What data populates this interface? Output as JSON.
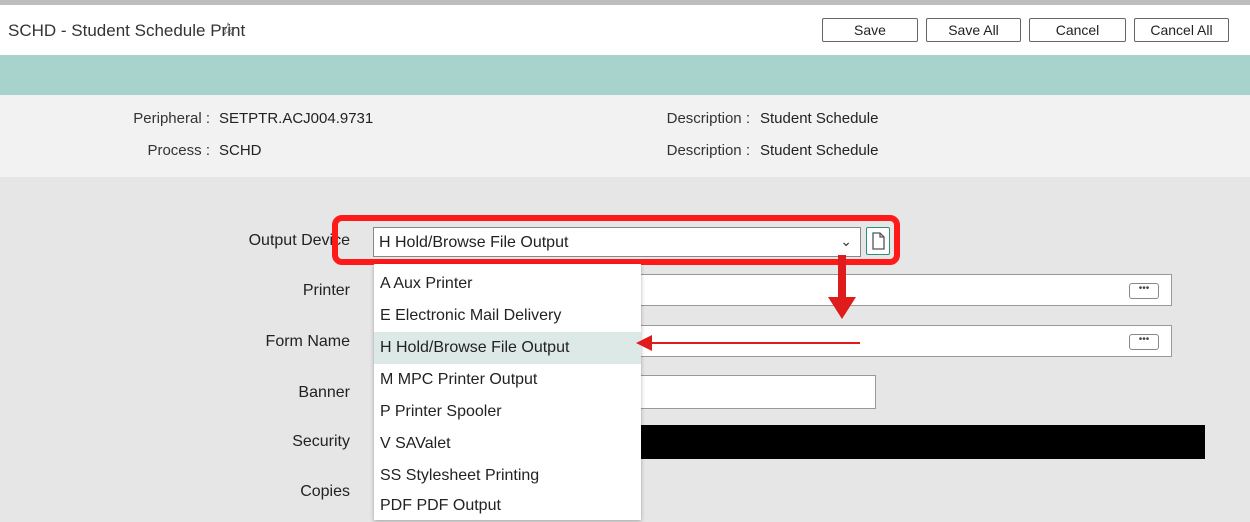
{
  "window": {
    "title": "SCHD - Student Schedule Print",
    "star_icon": "star-outline-icon"
  },
  "toolbar": {
    "save": "Save",
    "save_all": "Save All",
    "cancel": "Cancel",
    "cancel_all": "Cancel All"
  },
  "info": {
    "peripheral_label": "Peripheral :",
    "peripheral_value": "SETPTR.ACJ004.9731",
    "process_label": "Process :",
    "process_value": "SCHD",
    "desc1_label": "Description :",
    "desc1_value": "Student Schedule",
    "desc2_label": "Description :",
    "desc2_value": "Student Schedule"
  },
  "form": {
    "output_device_label": "Output Device",
    "output_device_value": "H Hold/Browse File Output",
    "printer_label": "Printer",
    "form_name_label": "Form Name",
    "banner_label": "Banner",
    "security_label": "Security",
    "copies_label": "Copies"
  },
  "dropdown": {
    "options": [
      "A Aux Printer",
      "E Electronic Mail Delivery",
      "H Hold/Browse File Output",
      "M MPC Printer Output",
      "P Printer Spooler",
      "V SAValet",
      "SS Stylesheet Printing",
      "PDF PDF Output"
    ],
    "selected_index": 2
  },
  "colors": {
    "teal_band": "#a8d3cc",
    "highlight_red": "#ff1a1a",
    "selected_row": "#dde9e7"
  }
}
